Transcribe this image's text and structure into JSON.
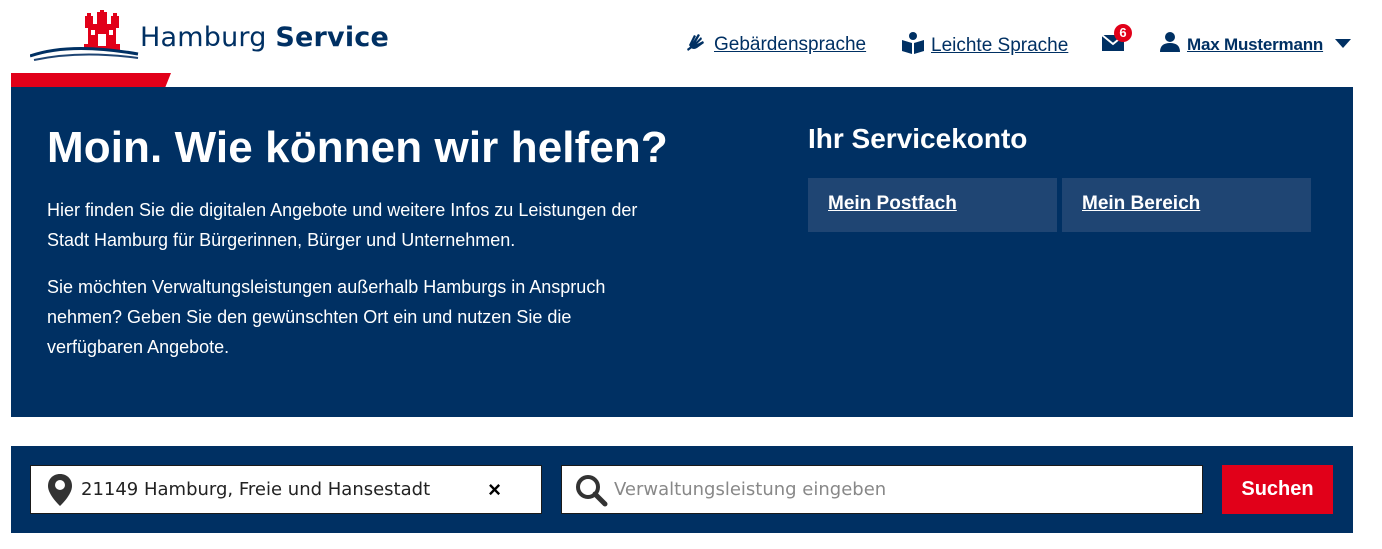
{
  "header": {
    "logo_text_regular": "Hamburg",
    "logo_text_bold": "Service",
    "logo_icon": "hamburg-castle-icon",
    "nav": {
      "sign_language": "Gebärdensprache",
      "sign_language_icon": "sign-language-hands-icon",
      "easy_language": "Leichte Sprache",
      "easy_language_icon": "book-reader-icon",
      "mail_icon": "envelope-icon",
      "mail_count": "6",
      "user_icon": "person-icon",
      "user_name": "Max Mustermann",
      "user_menu_icon": "caret-down-icon"
    }
  },
  "hero": {
    "title": "Moin. Wie können wir helfen?",
    "paragraph_1": "Hier finden Sie die digitalen Angebote und weitere Infos zu Leistungen der Stadt Hamburg für Bürgerinnen, Bürger und Unternehmen.",
    "paragraph_2": "Sie möchten Verwaltungsleistungen außerhalb Hamburgs in Anspruch nehmen? Geben Sie den gewünschten Ort ein und nutzen Sie die verfügbaren Angebote.",
    "servicekonto": {
      "title": "Ihr Servicekonto",
      "button_1": "Mein Postfach",
      "button_2": "Mein Bereich"
    }
  },
  "search": {
    "location_icon": "map-pin-icon",
    "location_value": "21149 Hamburg, Freie und Hansestadt",
    "clear_label": "×",
    "query_icon": "magnifier-icon",
    "query_placeholder": "Verwaltungsleistung eingeben",
    "query_value": "",
    "submit_label": "Suchen"
  },
  "colors": {
    "navy": "#003063",
    "navy_light": "#1f4573",
    "red": "#e10019",
    "white": "#ffffff"
  }
}
